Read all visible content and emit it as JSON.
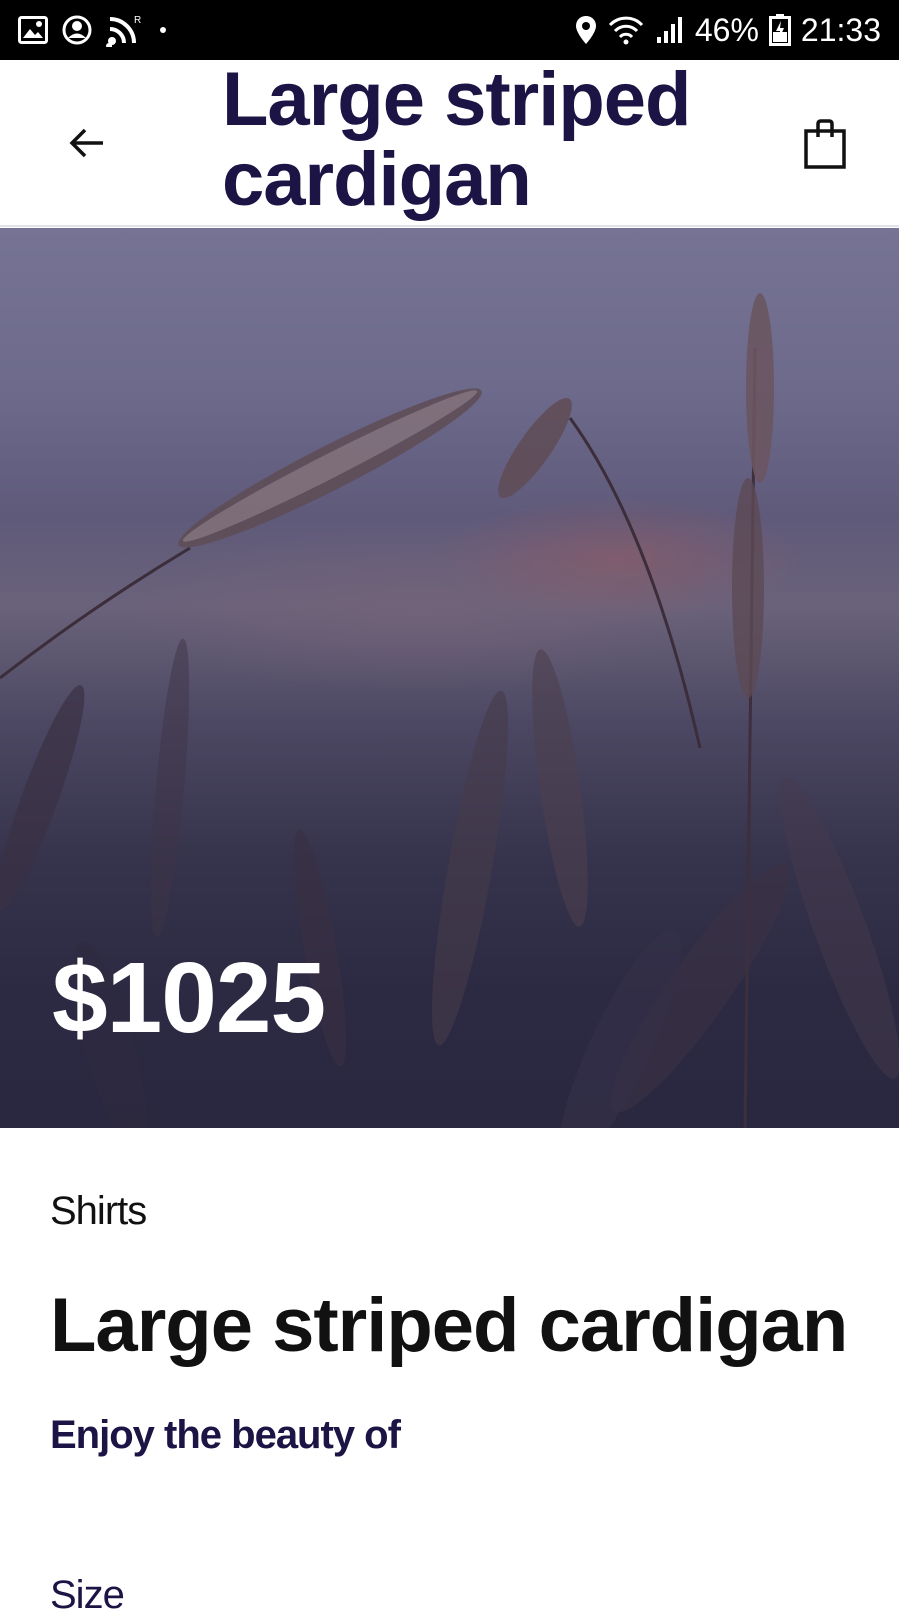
{
  "status_bar": {
    "icons": [
      "gallery-icon",
      "account-circle-icon",
      "wifi-calling-icon",
      "location-icon",
      "wifi-icon",
      "signal-icon",
      "battery-charging-icon"
    ],
    "battery": "46%",
    "time": "21:33"
  },
  "app_bar": {
    "title": "Large striped cardigan",
    "back_icon": "arrow-left-icon",
    "cart_icon": "shopping-bag-icon"
  },
  "hero": {
    "price": "$1025"
  },
  "product": {
    "category": "Shirts",
    "name": "Large striped cardigan",
    "description": "Enjoy the beauty of",
    "size_label": "Size"
  },
  "colors": {
    "title": "#1b1444",
    "text": "#111111",
    "status_bar": "#000000"
  }
}
